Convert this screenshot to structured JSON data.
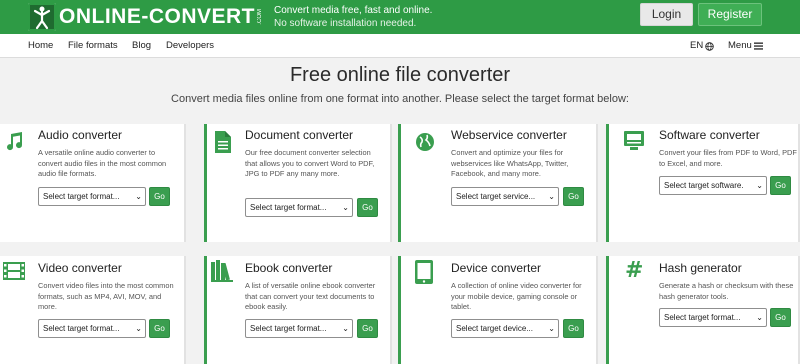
{
  "header": {
    "logo_text": "ONLINE-CONVERT",
    "logo_suffix": ".COM",
    "tagline_1": "Convert media free, fast and online.",
    "tagline_2": "No software installation needed.",
    "login_label": "Login",
    "register_label": "Register"
  },
  "nav": {
    "items": [
      "Home",
      "File formats",
      "Blog",
      "Developers"
    ],
    "language": "EN",
    "menu_label": "Menu"
  },
  "hero": {
    "title": "Free online file converter",
    "subtitle": "Convert media files online from one format into another. Please select the target format below:"
  },
  "go_label": "Go",
  "converters": [
    {
      "title": "Audio converter",
      "icon": "music-note-icon",
      "desc": "A versatile online audio converter to convert audio files in the most common audio file formats.",
      "select": "Select target format..."
    },
    {
      "title": "Document converter",
      "icon": "document-icon",
      "desc": "Our free document converter selection that allows you to convert Word to PDF, JPG to PDF any many more.",
      "select": "Select target format..."
    },
    {
      "title": "Webservice converter",
      "icon": "globe-icon",
      "desc": "Convert and optimize your files for webservices like WhatsApp, Twitter, Facebook, and many more.",
      "select": "Select target service..."
    },
    {
      "title": "Software converter",
      "icon": "computer-icon",
      "desc": "Convert your files from PDF to Word, PDF to Excel, and more.",
      "select": "Select target software."
    },
    {
      "title": "Video converter",
      "icon": "film-icon",
      "desc": "Convert video files into the most common formats, such as MP4, AVI, MOV, and more.",
      "select": "Select target format..."
    },
    {
      "title": "Ebook converter",
      "icon": "books-icon",
      "desc": "A list of versatile online ebook converter that can convert your text documents to ebook easily.",
      "select": "Select target format..."
    },
    {
      "title": "Device converter",
      "icon": "tablet-icon",
      "desc": "A collection of online video converter for your mobile device, gaming console or tablet.",
      "select": "Select target device..."
    },
    {
      "title": "Hash generator",
      "icon": "hash-icon",
      "desc": "Generate a hash or checksum with these hash generator tools.",
      "select": "Select target format..."
    }
  ],
  "colors": {
    "brand_green": "#2e9b45",
    "button_green": "#3a9e4f",
    "background": "#f2f2f2"
  }
}
